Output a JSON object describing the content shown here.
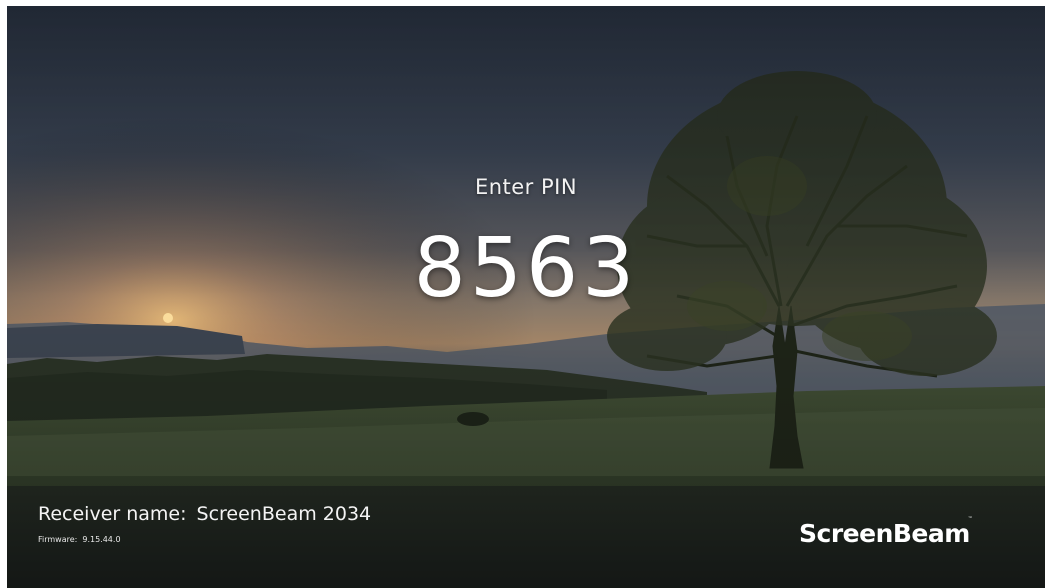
{
  "pin_screen": {
    "prompt": "Enter PIN",
    "pin": "8563"
  },
  "receiver": {
    "label": "Receiver name:",
    "name": "ScreenBeam 2034"
  },
  "firmware": {
    "label": "Firmware:",
    "version": "9.15.44.0"
  },
  "brand": {
    "logo_text": "ScreenBeam",
    "trademark": "™"
  },
  "colors": {
    "text": "#ffffff",
    "sky_top": "#2c3848",
    "horizon_glow": "#c9a06a",
    "field": "#3b4a2a"
  }
}
